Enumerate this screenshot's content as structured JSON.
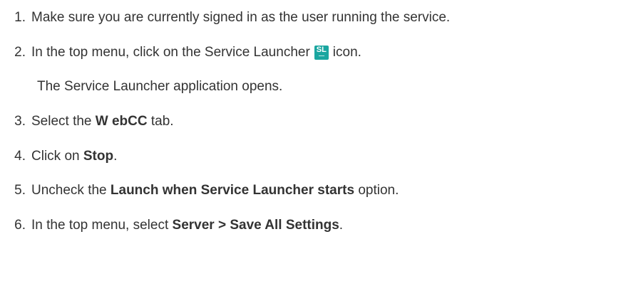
{
  "colors": {
    "text": "#333333",
    "icon_bg": "#1aa6a0"
  },
  "steps": [
    {
      "num": "1.",
      "before": "Make sure you are currently signed in as the user running the service."
    },
    {
      "num": "2.",
      "before": "In the top menu, click on the Service Launcher",
      "icon_label": "SL",
      "icon_name": "service-launcher-icon",
      "after": "icon."
    },
    {
      "sub": "The Service Launcher application opens."
    },
    {
      "num": "3.",
      "before": "Select the",
      "bold": "W ebCC",
      "after": "tab."
    },
    {
      "num": "4.",
      "before": "Click on",
      "bold": "Stop",
      "after": "."
    },
    {
      "num": "5.",
      "before": "Uncheck the",
      "bold": "Launch when Service Launcher starts",
      "after": "option."
    },
    {
      "num": "6.",
      "before": "In the top menu, select",
      "bold": "Server > Save All Settings",
      "after": "."
    }
  ]
}
